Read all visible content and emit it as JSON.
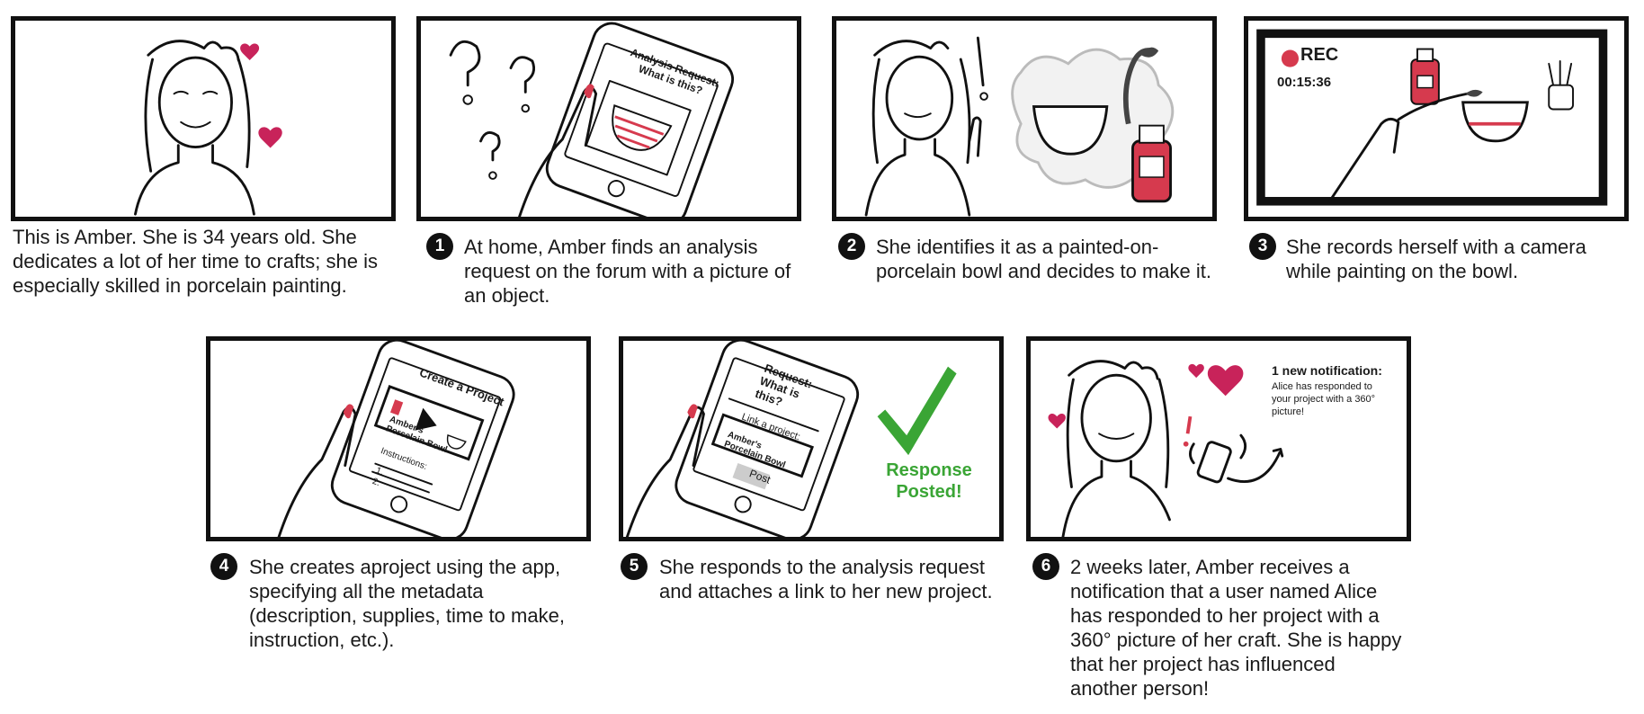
{
  "colors": {
    "accent_red": "#d63a4e",
    "heart_pink": "#c8235a",
    "check_green": "#3aa535",
    "ink": "#111111"
  },
  "intro": {
    "caption": "This is Amber. She is 34 years old. She dedicates a lot of her time to crafts; she is especially skilled in porcelain painting."
  },
  "panels": [
    {
      "number": "1",
      "caption": "At home, Amber finds an analysis request on the forum with a picture of an object.",
      "phone_text": "Analysis Request: What is this?"
    },
    {
      "number": "2",
      "caption": "She identifies it as a painted-on-porcelain bowl and decides to make it."
    },
    {
      "number": "3",
      "caption": "She records herself with a camera while painting on the bowl.",
      "rec_label": "REC",
      "timer": "00:15:36"
    },
    {
      "number": "4",
      "caption": "She creates aproject using the app, specifying all the metadata (description, supplies, time to make, instruction, etc.).",
      "phone_title": "Create a Project",
      "project_name": "Amber's Porcelain Bowl",
      "instructions_label": "Instructions:",
      "step1": "1.",
      "step2": "2."
    },
    {
      "number": "5",
      "caption": "She responds to the analysis request and attaches a link to her new project.",
      "phone_title": "Request: What is this?",
      "link_label": "Link a project:",
      "project_name": "Amber's Porcelain Bowl",
      "post_button": "Post",
      "response_text": "Response Posted!"
    },
    {
      "number": "6",
      "caption": "2 weeks later, Amber receives a notification that a user named Alice has responded to her project with a 360° picture of her craft. She is happy that her project has influenced another person!",
      "notification_title": "1 new notification:",
      "notification_body": "Alice has responded to your project with a 360° picture!"
    }
  ]
}
